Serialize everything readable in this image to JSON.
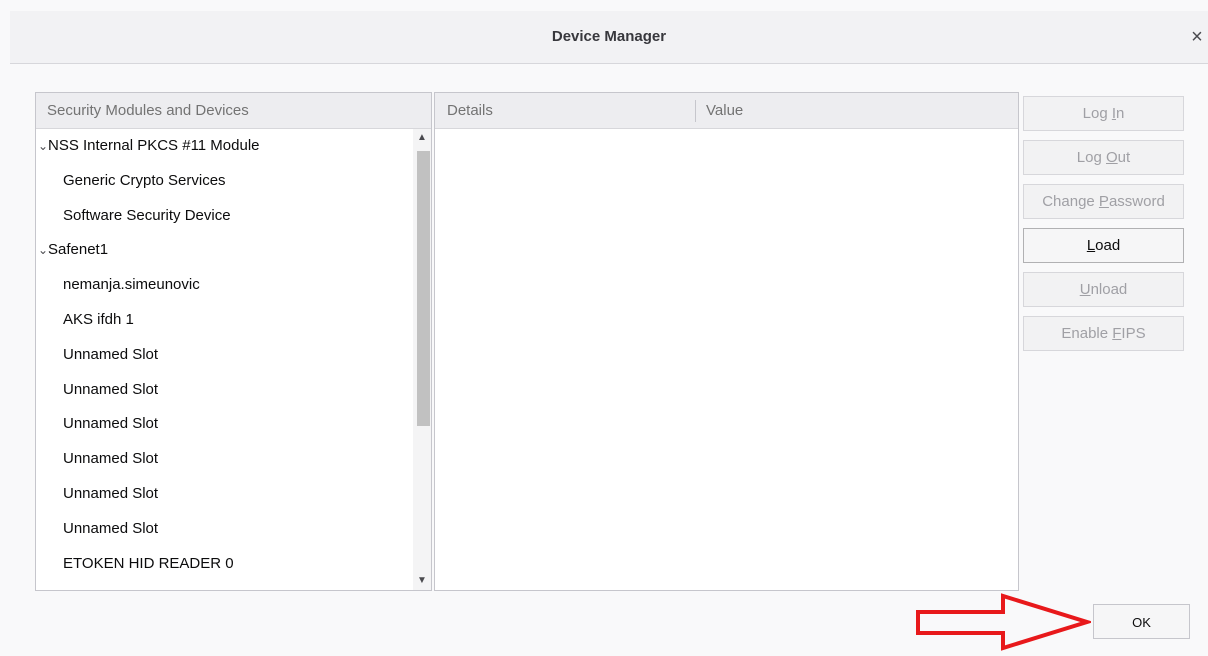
{
  "dialog": {
    "title": "Device Manager",
    "close_glyph": "×"
  },
  "tree": {
    "header": "Security Modules and Devices",
    "expand_glyph": "⌄",
    "items": [
      {
        "label": "NSS Internal PKCS #11 Module",
        "level": 0,
        "expanded": true
      },
      {
        "label": "Generic Crypto Services",
        "level": 1
      },
      {
        "label": "Software Security Device",
        "level": 1
      },
      {
        "label": "Safenet1",
        "level": 0,
        "expanded": true
      },
      {
        "label": "nemanja.simeunovic",
        "level": 1
      },
      {
        "label": "AKS ifdh 1",
        "level": 1
      },
      {
        "label": "Unnamed Slot",
        "level": 1
      },
      {
        "label": "Unnamed Slot",
        "level": 1
      },
      {
        "label": "Unnamed Slot",
        "level": 1
      },
      {
        "label": "Unnamed Slot",
        "level": 1
      },
      {
        "label": "Unnamed Slot",
        "level": 1
      },
      {
        "label": "Unnamed Slot",
        "level": 1
      },
      {
        "label": "ETOKEN HID READER 0",
        "level": 1
      }
    ],
    "scroll_up_glyph": "▲",
    "scroll_down_glyph": "▼"
  },
  "details": {
    "col_details": "Details",
    "col_value": "Value"
  },
  "buttons": {
    "login": {
      "pre": "Log ",
      "accel": "I",
      "post": "n",
      "enabled": false
    },
    "logout": {
      "pre": "Log ",
      "accel": "O",
      "post": "ut",
      "enabled": false
    },
    "change_password": {
      "pre": "Change ",
      "accel": "P",
      "post": "assword",
      "enabled": false
    },
    "load": {
      "pre": "",
      "accel": "L",
      "post": "oad",
      "enabled": true
    },
    "unload": {
      "pre": "",
      "accel": "U",
      "post": "nload",
      "enabled": false
    },
    "enable_fips": {
      "pre": "Enable ",
      "accel": "F",
      "post": "IPS",
      "enabled": false
    },
    "ok": "OK"
  },
  "colors": {
    "annotation_arrow": "#e8191b"
  }
}
